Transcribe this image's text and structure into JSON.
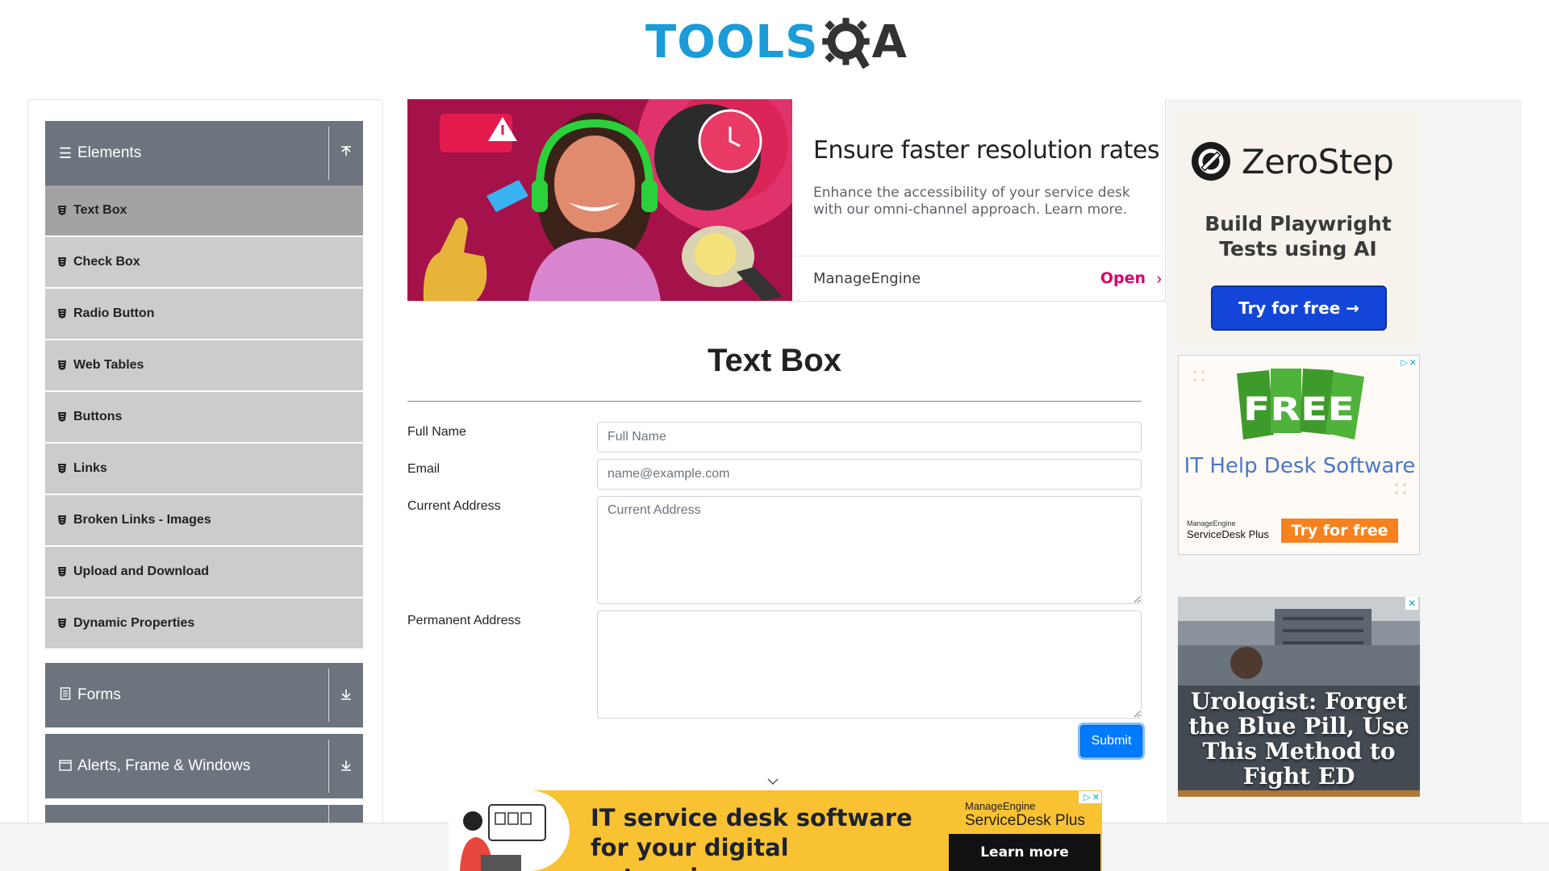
{
  "header": {
    "logo_tools": "TOOLS",
    "logo_a": "A",
    "logo_colors": {
      "tools": "#1b9bd7",
      "qa": "#333333"
    }
  },
  "sidebar": {
    "groups": [
      {
        "label": "Elements",
        "icon": "hamburger-icon",
        "arrow": "upload-arrow-icon",
        "expanded": true
      },
      {
        "label": "Forms",
        "icon": "document-icon",
        "arrow": "download-arrow-icon",
        "expanded": false
      },
      {
        "label": "Alerts, Frame & Windows",
        "icon": "window-icon",
        "arrow": "download-arrow-icon",
        "expanded": false
      }
    ],
    "items": [
      {
        "label": "Text Box",
        "active": true
      },
      {
        "label": "Check Box"
      },
      {
        "label": "Radio Button"
      },
      {
        "label": "Web Tables"
      },
      {
        "label": "Buttons"
      },
      {
        "label": "Links"
      },
      {
        "label": "Broken Links - Images"
      },
      {
        "label": "Upload and Download"
      },
      {
        "label": "Dynamic Properties"
      }
    ]
  },
  "top_ad": {
    "headline": "Ensure faster resolution rates",
    "description": "Enhance the accessibility of your service desk with our omni-channel approach. Learn more.",
    "advertiser": "ManageEngine",
    "cta": "Open"
  },
  "main": {
    "title": "Text Box",
    "fields": {
      "full_name": {
        "label": "Full Name",
        "placeholder": "Full Name",
        "value": ""
      },
      "email": {
        "label": "Email",
        "placeholder": "name@example.com",
        "value": ""
      },
      "current_address": {
        "label": "Current Address",
        "placeholder": "Current Address",
        "value": ""
      },
      "permanent_address": {
        "label": "Permanent Address",
        "placeholder": "",
        "value": ""
      }
    },
    "submit_label": "Submit"
  },
  "right_ads": {
    "zerostep": {
      "brand": "ZeroStep",
      "tagline": "Build Playwright Tests using AI",
      "cta": "Try for free →"
    },
    "free_ad": {
      "badge": "FREE",
      "title": "IT Help Desk Software",
      "brand_small": "ManageEngine",
      "brand": "ServiceDesk Plus",
      "cta": "Try for free"
    },
    "news_ad": {
      "headline": "Urologist: Forget the Blue Pill, Use This Method to Fight ED"
    }
  },
  "bottom_ad": {
    "headline": "IT service desk software for your digital enterprise",
    "brand_small": "ManageEngine",
    "brand": "ServiceDesk Plus",
    "cta": "Learn more"
  }
}
